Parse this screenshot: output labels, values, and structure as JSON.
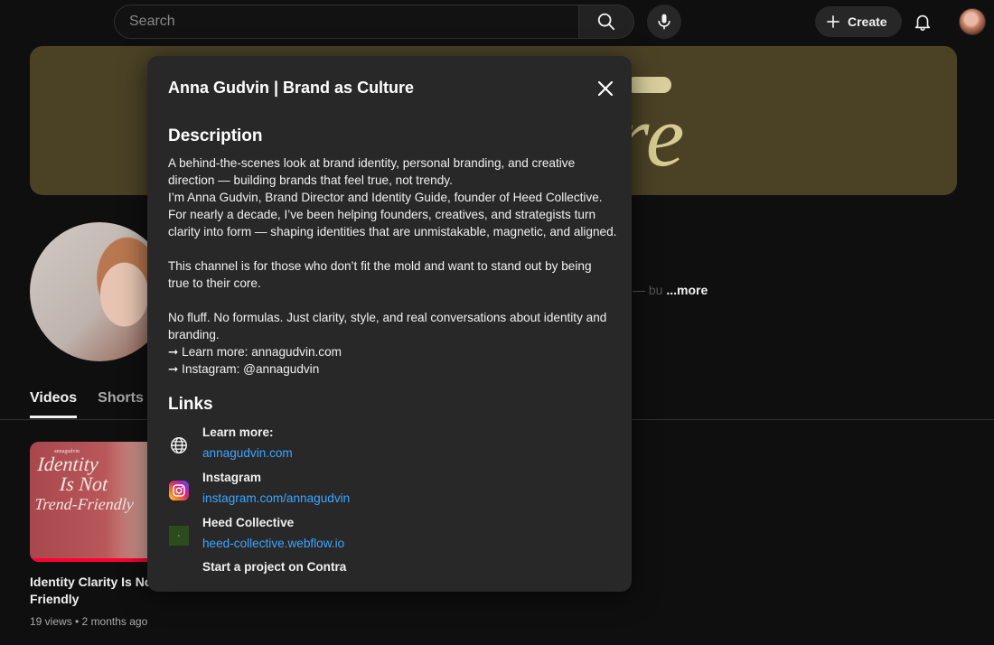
{
  "header": {
    "search_placeholder": "Search",
    "create_label": "Create"
  },
  "banner": {
    "script_text": "re"
  },
  "channel": {
    "about_more": "...more",
    "about_fragment": "— bu"
  },
  "tabs": [
    {
      "label": "Videos",
      "active": true
    },
    {
      "label": "Shorts",
      "active": false
    }
  ],
  "video": {
    "thumb_small": "annagudvin",
    "thumb_line1": "Identity",
    "thumb_line2": "Is Not",
    "thumb_line3": "Trend-Friendly",
    "title_line1": "Identity Clarity Is Not",
    "title_line2": "Friendly",
    "meta": "19 views • 2 months ago"
  },
  "modal": {
    "title": "Anna Gudvin | Brand as Culture",
    "description_heading": "Description",
    "description": "A behind-the-scenes look at brand identity, personal branding, and creative\ndirection — building brands that feel true, not trendy.\nI’m Anna Gudvin, Brand Director and Identity Guide,  founder of Heed Collective.\nFor nearly a decade, I’ve been helping founders, creatives, and strategists turn\nclarity into form — shaping identities that are unmistakable, magnetic, and aligned.\n\nThis channel is for those who don’t fit the mold and want to stand out by being\ntrue to their core.\n\nNo fluff. No formulas. Just clarity, style, and real conversations about identity and\nbranding.\n➞ Learn more: annagudvin.com\n➞ Instagram: @annagudvin",
    "links_heading": "Links",
    "links": [
      {
        "label": "Learn more:",
        "url": "annagudvin.com",
        "icon": "globe-icon"
      },
      {
        "label": "Instagram",
        "url": "instagram.com/annagudvin",
        "icon": "instagram-icon"
      },
      {
        "label": "Heed Collective",
        "url": "heed-collective.webflow.io",
        "icon": "heed-collective-icon"
      }
    ],
    "cut_off_link": "Start a project on Contra"
  },
  "colors": {
    "background": "#0f0f0f",
    "modal": "#282828",
    "link": "#3ea6ff",
    "banner": "#4b4226",
    "progress": "#ff0033"
  }
}
